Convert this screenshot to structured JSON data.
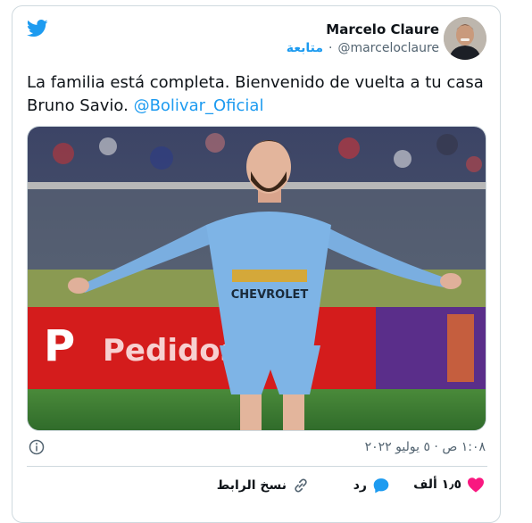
{
  "tweet": {
    "author_name": "Marcelo Claure",
    "author_handle": "@marceloclaure",
    "follow_label": "متابعة",
    "separator": "·",
    "text_main": "La familia está completa. Bienvenido de vuelta a tu casa Bruno Savio.",
    "mention": "@Bolivar_Oficial",
    "image_banner_text": "Pedidos",
    "jersey_sponsor": "CHEVROLET",
    "timestamp": "١:٠٨ ص · ٥ يوليو ٢٠٢٢",
    "likes_count": "١٫٥ ألف",
    "reply_label": "رد",
    "copy_link_label": "نسخ الرابط"
  },
  "colors": {
    "twitter_blue": "#1d9bf0",
    "like_pink": "#f91880",
    "text_primary": "#0f1419",
    "text_secondary": "#536471",
    "border": "#cfd9de"
  },
  "icons": {
    "logo": "twitter-bird-icon",
    "info": "info-icon",
    "like": "heart-icon",
    "reply": "speech-bubble-icon",
    "copy": "link-icon"
  }
}
